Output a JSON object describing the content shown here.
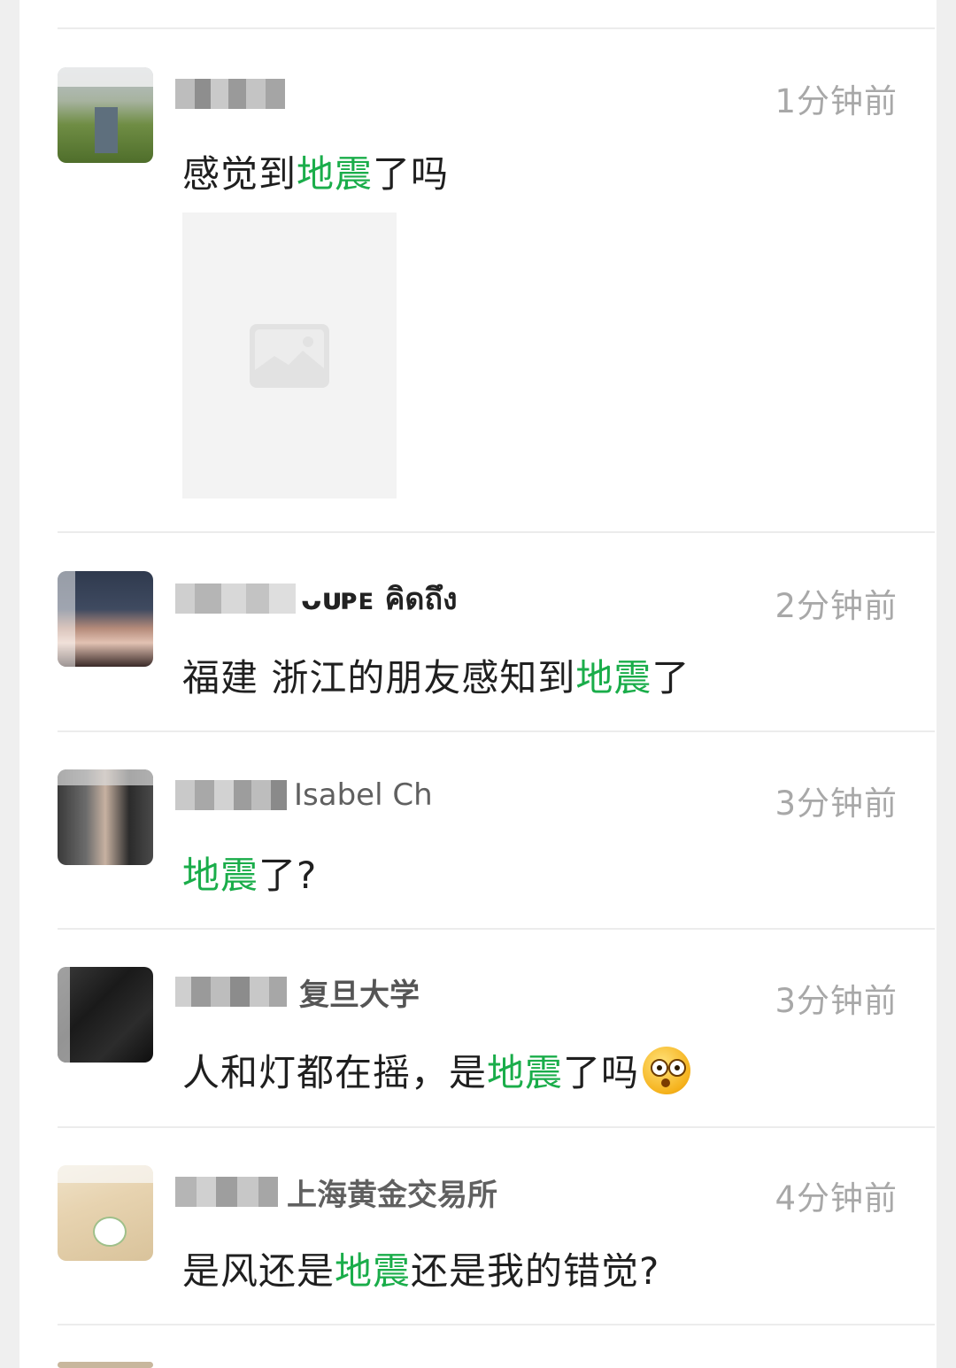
{
  "comments": [
    {
      "time": "1分钟前",
      "text_before": "感觉到",
      "keyword": "地震",
      "text_after": "了吗"
    },
    {
      "name_visible": "ᴗᴜᴘᴇ คิดถึง",
      "time": "2分钟前",
      "text_before": "福建 浙江的朋友感知到",
      "keyword": "地震",
      "text_after": "了"
    },
    {
      "name_visible": "Isabel Ch",
      "time": "3分钟前",
      "text_before": "",
      "keyword": "地震",
      "text_after": "了?"
    },
    {
      "name_visible": "复旦大学",
      "time": "3分钟前",
      "text_before": "人和灯都在摇，是",
      "keyword": "地震",
      "text_after": "了吗",
      "emoji": "flushed-face-emoji"
    },
    {
      "name_visible": "上海黄金交易所",
      "time": "4分钟前",
      "text_before": "是风还是",
      "keyword": "地震",
      "text_after": "还是我的错觉?"
    }
  ],
  "colors": {
    "keyword": "#1aad4a",
    "time": "#a8a8a8",
    "text": "#1f1f1f"
  },
  "icons": {
    "image_placeholder": "image-icon"
  }
}
